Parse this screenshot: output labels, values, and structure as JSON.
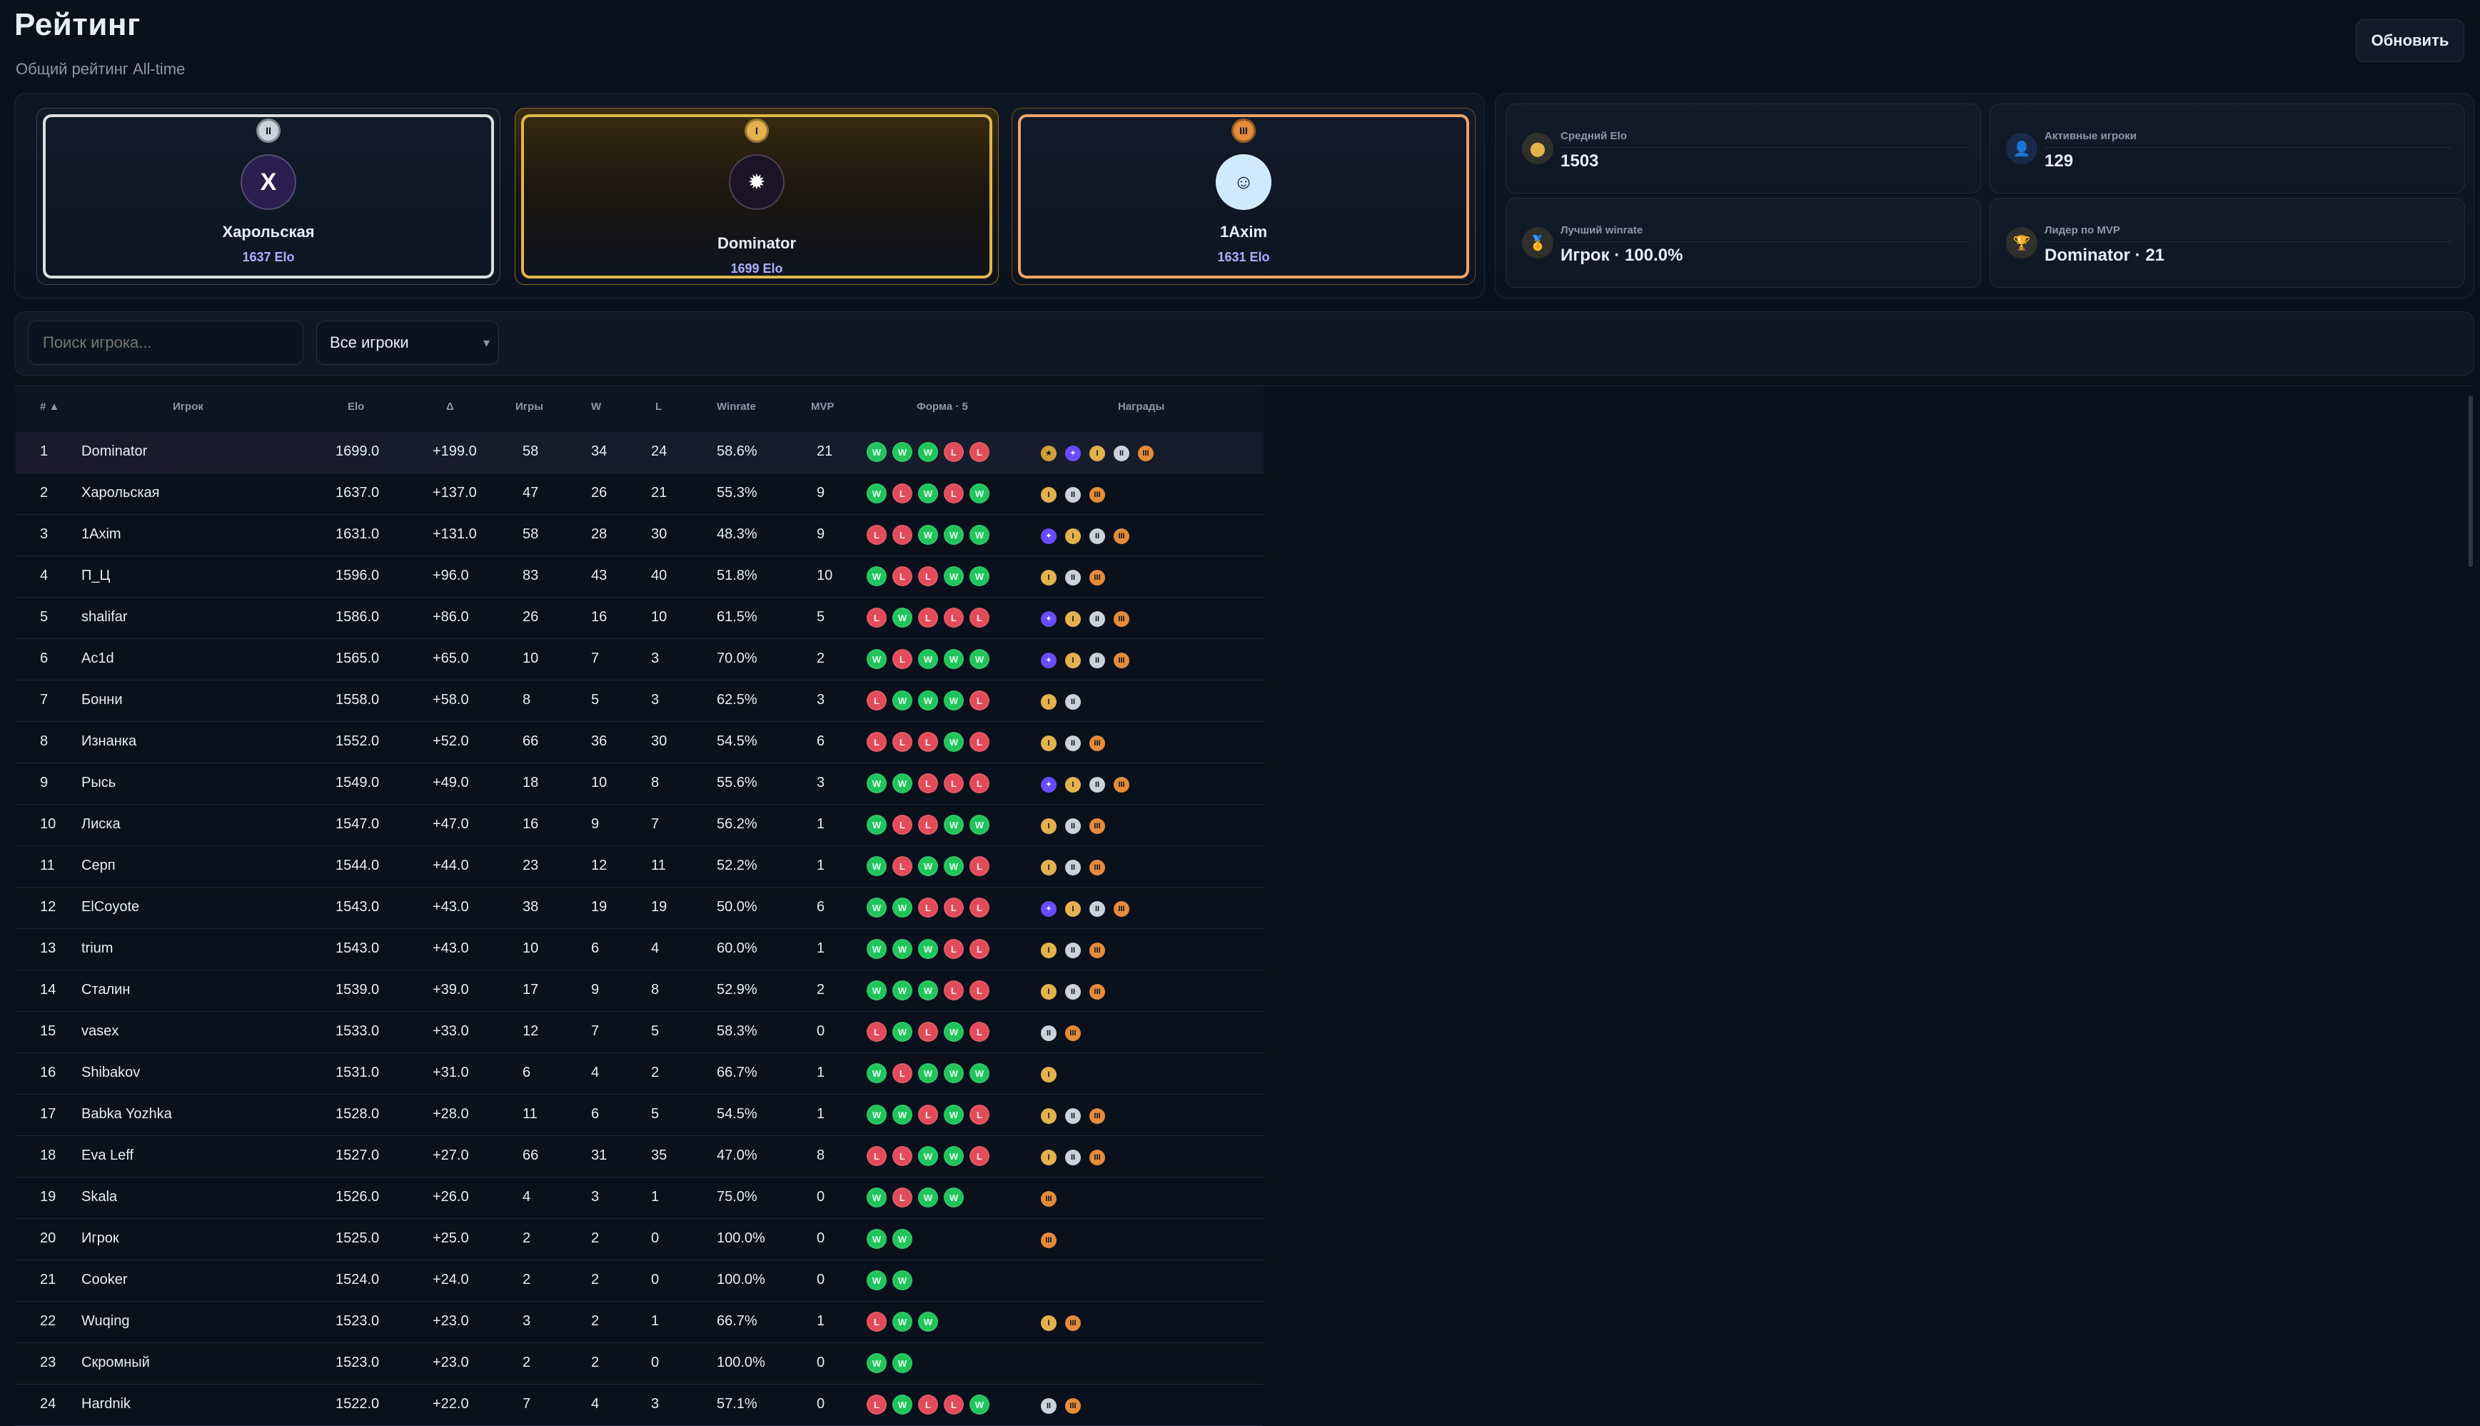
{
  "header": {
    "title": "Рейтинг",
    "subtitle": "Общий рейтинг All-time",
    "refresh_label": "Обновить"
  },
  "podium": [
    {
      "rank": "II",
      "avatar_text": "X",
      "name": "Харольская",
      "elo": "1637 Elo",
      "tier": "silver"
    },
    {
      "rank": "I",
      "avatar_text": "",
      "name": "Dominator",
      "elo": "1699 Elo",
      "tier": "gold"
    },
    {
      "rank": "III",
      "avatar_text": "",
      "name": "1Axim",
      "elo": "1631 Elo",
      "tier": "bronze"
    }
  ],
  "stats": [
    {
      "label": "Средний Elo",
      "value": "1503",
      "icon": "medal-icon"
    },
    {
      "label": "Активные игроки",
      "value": "129",
      "icon": "users-icon"
    },
    {
      "label": "Лучший winrate",
      "value": "Игрок · 100.0%",
      "icon": "trophy-icon"
    },
    {
      "label": "Лидер по MVP",
      "value": "Dominator · 21",
      "icon": "star-icon"
    }
  ],
  "filters": {
    "search_placeholder": "Поиск игрока...",
    "select_value": "Все игроки"
  },
  "table": {
    "headers": {
      "rank": "#",
      "player": "Игрок",
      "elo": "Elo",
      "delta": "Δ",
      "games": "Игры",
      "w": "W",
      "l": "L",
      "winrate": "Winrate",
      "mvp": "MVP",
      "form": "Форма · 5",
      "awards": "Награды"
    },
    "rows": [
      {
        "rank": "1",
        "player": "Dominator",
        "elo": "1699.0",
        "delta": "+199.0",
        "games": "58",
        "w": "34",
        "l": "24",
        "winrate": "58.6%",
        "mvp": "21",
        "form": [
          "W",
          "W",
          "W",
          "L",
          "L"
        ],
        "awards": [
          "champ",
          "trophy",
          "gold",
          "silver",
          "bronze"
        ]
      },
      {
        "rank": "2",
        "player": "Харольская",
        "elo": "1637.0",
        "delta": "+137.0",
        "games": "47",
        "w": "26",
        "l": "21",
        "winrate": "55.3%",
        "mvp": "9",
        "form": [
          "W",
          "L",
          "W",
          "L",
          "W"
        ],
        "awards": [
          "gold",
          "silver",
          "bronze"
        ]
      },
      {
        "rank": "3",
        "player": "1Axim",
        "elo": "1631.0",
        "delta": "+131.0",
        "games": "58",
        "w": "28",
        "l": "30",
        "winrate": "48.3%",
        "mvp": "9",
        "form": [
          "L",
          "L",
          "W",
          "W",
          "W"
        ],
        "awards": [
          "trophy",
          "gold",
          "silver",
          "bronze"
        ]
      },
      {
        "rank": "4",
        "player": "П_Ц",
        "elo": "1596.0",
        "delta": "+96.0",
        "games": "83",
        "w": "43",
        "l": "40",
        "winrate": "51.8%",
        "mvp": "10",
        "form": [
          "W",
          "L",
          "L",
          "W",
          "W"
        ],
        "awards": [
          "gold",
          "silver",
          "bronze"
        ]
      },
      {
        "rank": "5",
        "player": "shalifar",
        "elo": "1586.0",
        "delta": "+86.0",
        "games": "26",
        "w": "16",
        "l": "10",
        "winrate": "61.5%",
        "mvp": "5",
        "form": [
          "L",
          "W",
          "L",
          "L",
          "L"
        ],
        "awards": [
          "trophy",
          "gold",
          "silver",
          "bronze"
        ]
      },
      {
        "rank": "6",
        "player": "Ac1d",
        "elo": "1565.0",
        "delta": "+65.0",
        "games": "10",
        "w": "7",
        "l": "3",
        "winrate": "70.0%",
        "mvp": "2",
        "form": [
          "W",
          "L",
          "W",
          "W",
          "W"
        ],
        "awards": [
          "trophy",
          "gold",
          "silver",
          "bronze"
        ]
      },
      {
        "rank": "7",
        "player": "Бонни",
        "elo": "1558.0",
        "delta": "+58.0",
        "games": "8",
        "w": "5",
        "l": "3",
        "winrate": "62.5%",
        "mvp": "3",
        "form": [
          "L",
          "W",
          "W",
          "W",
          "L"
        ],
        "awards": [
          "gold",
          "silver"
        ]
      },
      {
        "rank": "8",
        "player": "Изнанка",
        "elo": "1552.0",
        "delta": "+52.0",
        "games": "66",
        "w": "36",
        "l": "30",
        "winrate": "54.5%",
        "mvp": "6",
        "form": [
          "L",
          "L",
          "L",
          "W",
          "L"
        ],
        "awards": [
          "gold",
          "silver",
          "bronze"
        ]
      },
      {
        "rank": "9",
        "player": "Рысь",
        "elo": "1549.0",
        "delta": "+49.0",
        "games": "18",
        "w": "10",
        "l": "8",
        "winrate": "55.6%",
        "mvp": "3",
        "form": [
          "W",
          "W",
          "L",
          "L",
          "L"
        ],
        "awards": [
          "trophy",
          "gold",
          "silver",
          "bronze"
        ]
      },
      {
        "rank": "10",
        "player": "Лиска",
        "elo": "1547.0",
        "delta": "+47.0",
        "games": "16",
        "w": "9",
        "l": "7",
        "winrate": "56.2%",
        "mvp": "1",
        "form": [
          "W",
          "L",
          "L",
          "W",
          "W"
        ],
        "awards": [
          "gold",
          "silver",
          "bronze"
        ]
      },
      {
        "rank": "11",
        "player": "Серп",
        "elo": "1544.0",
        "delta": "+44.0",
        "games": "23",
        "w": "12",
        "l": "11",
        "winrate": "52.2%",
        "mvp": "1",
        "form": [
          "W",
          "L",
          "W",
          "W",
          "L"
        ],
        "awards": [
          "gold",
          "silver",
          "bronze"
        ]
      },
      {
        "rank": "12",
        "player": "ElCoyote",
        "elo": "1543.0",
        "delta": "+43.0",
        "games": "38",
        "w": "19",
        "l": "19",
        "winrate": "50.0%",
        "mvp": "6",
        "form": [
          "W",
          "W",
          "L",
          "L",
          "L"
        ],
        "awards": [
          "trophy",
          "gold",
          "silver",
          "bronze"
        ]
      },
      {
        "rank": "13",
        "player": "trium",
        "elo": "1543.0",
        "delta": "+43.0",
        "games": "10",
        "w": "6",
        "l": "4",
        "winrate": "60.0%",
        "mvp": "1",
        "form": [
          "W",
          "W",
          "W",
          "L",
          "L"
        ],
        "awards": [
          "gold",
          "silver",
          "bronze"
        ]
      },
      {
        "rank": "14",
        "player": "Сталин",
        "elo": "1539.0",
        "delta": "+39.0",
        "games": "17",
        "w": "9",
        "l": "8",
        "winrate": "52.9%",
        "mvp": "2",
        "form": [
          "W",
          "W",
          "W",
          "L",
          "L"
        ],
        "awards": [
          "gold",
          "silver",
          "bronze"
        ]
      },
      {
        "rank": "15",
        "player": "vasex",
        "elo": "1533.0",
        "delta": "+33.0",
        "games": "12",
        "w": "7",
        "l": "5",
        "winrate": "58.3%",
        "mvp": "0",
        "form": [
          "L",
          "W",
          "L",
          "W",
          "L"
        ],
        "awards": [
          "silver",
          "bronze"
        ]
      },
      {
        "rank": "16",
        "player": "Shibakov",
        "elo": "1531.0",
        "delta": "+31.0",
        "games": "6",
        "w": "4",
        "l": "2",
        "winrate": "66.7%",
        "mvp": "1",
        "form": [
          "W",
          "L",
          "W",
          "W",
          "W"
        ],
        "awards": [
          "gold"
        ]
      },
      {
        "rank": "17",
        "player": "Babka Yozhka",
        "elo": "1528.0",
        "delta": "+28.0",
        "games": "11",
        "w": "6",
        "l": "5",
        "winrate": "54.5%",
        "mvp": "1",
        "form": [
          "W",
          "W",
          "L",
          "W",
          "L"
        ],
        "awards": [
          "gold",
          "silver",
          "bronze"
        ]
      },
      {
        "rank": "18",
        "player": "Eva Leff",
        "elo": "1527.0",
        "delta": "+27.0",
        "games": "66",
        "w": "31",
        "l": "35",
        "winrate": "47.0%",
        "mvp": "8",
        "form": [
          "L",
          "L",
          "W",
          "W",
          "L"
        ],
        "awards": [
          "gold",
          "silver",
          "bronze"
        ]
      },
      {
        "rank": "19",
        "player": "Skala",
        "elo": "1526.0",
        "delta": "+26.0",
        "games": "4",
        "w": "3",
        "l": "1",
        "winrate": "75.0%",
        "mvp": "0",
        "form": [
          "W",
          "L",
          "W",
          "W"
        ],
        "awards": [
          "bronze"
        ]
      },
      {
        "rank": "20",
        "player": "Игрок",
        "elo": "1525.0",
        "delta": "+25.0",
        "games": "2",
        "w": "2",
        "l": "0",
        "winrate": "100.0%",
        "mvp": "0",
        "form": [
          "W",
          "W"
        ],
        "awards": [
          "bronze"
        ]
      },
      {
        "rank": "21",
        "player": "Cooker",
        "elo": "1524.0",
        "delta": "+24.0",
        "games": "2",
        "w": "2",
        "l": "0",
        "winrate": "100.0%",
        "mvp": "0",
        "form": [
          "W",
          "W"
        ],
        "awards": []
      },
      {
        "rank": "22",
        "player": "Wuqing",
        "elo": "1523.0",
        "delta": "+23.0",
        "games": "3",
        "w": "2",
        "l": "1",
        "winrate": "66.7%",
        "mvp": "1",
        "form": [
          "L",
          "W",
          "W"
        ],
        "awards": [
          "gold",
          "bronze"
        ]
      },
      {
        "rank": "23",
        "player": "Скромный",
        "elo": "1523.0",
        "delta": "+23.0",
        "games": "2",
        "w": "2",
        "l": "0",
        "winrate": "100.0%",
        "mvp": "0",
        "form": [
          "W",
          "W"
        ],
        "awards": []
      },
      {
        "rank": "24",
        "player": "Hardnik",
        "elo": "1522.0",
        "delta": "+22.0",
        "games": "7",
        "w": "4",
        "l": "3",
        "winrate": "57.1%",
        "mvp": "0",
        "form": [
          "L",
          "W",
          "L",
          "L",
          "W"
        ],
        "awards": [
          "silver",
          "bronze"
        ]
      }
    ]
  }
}
